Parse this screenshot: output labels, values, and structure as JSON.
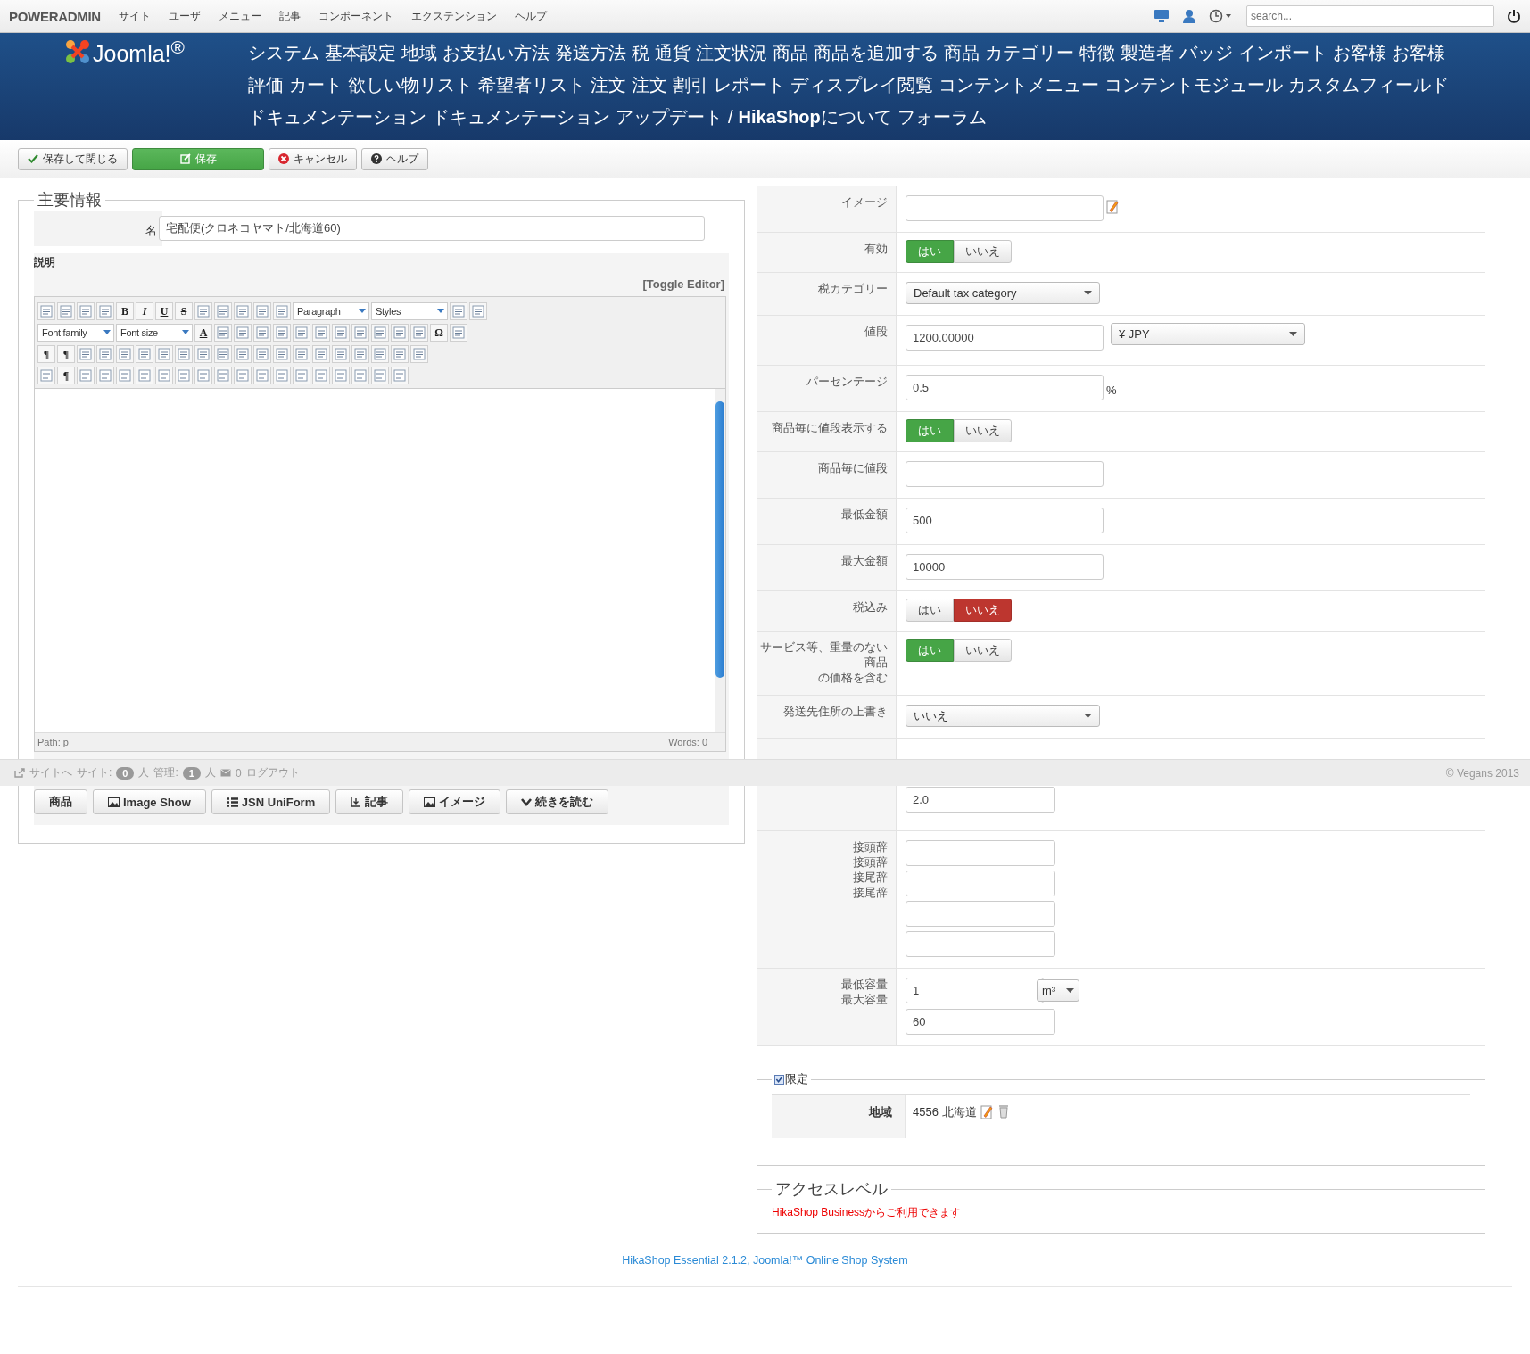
{
  "topbar": {
    "brand": "POWERADMIN",
    "menu": [
      "サイト",
      "ユーザ",
      "メニュー",
      "記事",
      "コンポーネント",
      "エクステンション",
      "ヘルプ"
    ],
    "search": {
      "placeholder": "search..."
    }
  },
  "header": {
    "logo": "Joomla!$^{®}$",
    "nav": [
      "システム",
      "基本設定",
      "地域",
      "お支払い方法",
      "発送方法",
      "税",
      "通貨",
      "注文状況",
      "商品",
      "商品を追加する",
      "商品",
      "カテゴリー",
      "特徴",
      "製造者",
      "バッジ",
      "インポート",
      "お客様",
      "お客様",
      "評価",
      "カート",
      "欲しい物リスト",
      "希望者リスト",
      "注文",
      "注文",
      "割引",
      "レポート",
      "ディスプレイ閲覧",
      "コンテントメニュー",
      "コンテントモジュール",
      "カスタムフィールド",
      "ドキュメンテーション",
      "ドキュメンテーション",
      "アップデート",
      "/",
      "**HikaShop**について",
      "フォーラム"
    ]
  },
  "toolbar": [
    {
      "kind": "save_close",
      "label": "保存して閉じる"
    },
    {
      "kind": "save",
      "label": "保存"
    },
    {
      "kind": "cancel",
      "label": "キャンセル"
    },
    {
      "kind": "help",
      "label": "ヘルプ"
    }
  ],
  "main": {
    "legend": "主要情報",
    "name_label": "名",
    "name_value": "宅配便(クロネコヤマト/北海道60)",
    "description_label": "説明",
    "toggle_editor": "[Toggle Editor]",
    "editor_rows": [
      [
        {
          "kind": "icon"
        },
        {
          "kind": "icon"
        },
        {
          "kind": "icon"
        },
        {
          "kind": "icon"
        },
        {
          "kind": "bold",
          "label": "B"
        },
        {
          "kind": "italic",
          "label": "I"
        },
        {
          "kind": "underline",
          "label": "U"
        },
        {
          "kind": "strike",
          "label": "S"
        },
        {
          "kind": "icon"
        },
        {
          "kind": "icon"
        },
        {
          "kind": "icon"
        },
        {
          "kind": "icon"
        },
        {
          "kind": "icon"
        },
        {
          "kind": "select",
          "label": "Paragraph"
        },
        {
          "kind": "select",
          "label": "Styles"
        },
        {
          "kind": "icon"
        },
        {
          "kind": "icon"
        }
      ],
      [
        {
          "kind": "select",
          "label": "Font family"
        },
        {
          "kind": "select",
          "label": "Font size"
        },
        {
          "kind": "underline",
          "label": "A"
        },
        {
          "kind": "icon"
        },
        {
          "kind": "icon"
        },
        {
          "kind": "icon"
        },
        {
          "kind": "icon"
        },
        {
          "kind": "icon"
        },
        {
          "kind": "icon"
        },
        {
          "kind": "icon"
        },
        {
          "kind": "icon"
        },
        {
          "kind": "icon"
        },
        {
          "kind": "icon"
        },
        {
          "kind": "icon"
        },
        {
          "kind": "text",
          "label": "Ω"
        },
        {
          "kind": "icon"
        }
      ],
      [
        {
          "kind": "text",
          "label": "¶"
        },
        {
          "kind": "text",
          "label": "¶"
        },
        {
          "kind": "icon"
        },
        {
          "kind": "icon"
        },
        {
          "kind": "icon"
        },
        {
          "kind": "icon"
        },
        {
          "kind": "icon"
        },
        {
          "kind": "icon"
        },
        {
          "kind": "icon"
        },
        {
          "kind": "icon"
        },
        {
          "kind": "icon"
        },
        {
          "kind": "icon"
        },
        {
          "kind": "icon"
        },
        {
          "kind": "icon"
        },
        {
          "kind": "icon"
        },
        {
          "kind": "icon"
        },
        {
          "kind": "icon"
        },
        {
          "kind": "icon"
        },
        {
          "kind": "icon"
        },
        {
          "kind": "icon"
        }
      ],
      [
        {
          "kind": "icon"
        },
        {
          "kind": "text",
          "label": "¶"
        },
        {
          "kind": "icon"
        },
        {
          "kind": "icon"
        },
        {
          "kind": "icon"
        },
        {
          "kind": "icon"
        },
        {
          "kind": "icon"
        },
        {
          "kind": "icon"
        },
        {
          "kind": "icon"
        },
        {
          "kind": "icon"
        },
        {
          "kind": "icon"
        },
        {
          "kind": "icon"
        },
        {
          "kind": "icon"
        },
        {
          "kind": "icon"
        },
        {
          "kind": "icon"
        },
        {
          "kind": "icon"
        },
        {
          "kind": "icon"
        },
        {
          "kind": "icon"
        },
        {
          "kind": "icon"
        }
      ]
    ],
    "path": "Path:  p",
    "words": "Words: 0",
    "editor_buttons": [
      {
        "kind": "plain",
        "label": "商品"
      },
      {
        "kind": "image",
        "label": "Image Show"
      },
      {
        "kind": "list",
        "label": "JSN UniForm"
      },
      {
        "kind": "article",
        "label": "記事"
      },
      {
        "kind": "image",
        "label": "イメージ"
      },
      {
        "kind": "more",
        "label": "続きを読む"
      }
    ]
  },
  "fields": [
    {
      "kind": "image",
      "labels": [
        "イメージ"
      ]
    },
    {
      "kind": "toggle",
      "labels": [
        "有効"
      ],
      "options": [
        {
          "kind": "yes",
          "label": "はい",
          "selected": true
        },
        {
          "kind": "no",
          "label": "いいえ",
          "selected": false
        }
      ]
    },
    {
      "kind": "select",
      "labels": [
        "税カテゴリー"
      ],
      "value": "Default tax category"
    },
    {
      "kind": "price",
      "labels": [
        "値段"
      ],
      "value": "1200.00000",
      "unit": "¥  JPY"
    },
    {
      "kind": "percent",
      "labels": [
        "パーセンテージ"
      ],
      "value": "0.5",
      "suffix": "%"
    },
    {
      "kind": "toggle",
      "labels": [
        "商品毎に値段表示する"
      ],
      "options": [
        {
          "kind": "yes",
          "label": "はい",
          "selected": true
        },
        {
          "kind": "no",
          "label": "いいえ",
          "selected": false
        }
      ]
    },
    {
      "kind": "input",
      "labels": [
        "商品毎に値段"
      ]
    },
    {
      "kind": "input",
      "labels": [
        "最低金額"
      ],
      "value": "500"
    },
    {
      "kind": "input",
      "labels": [
        "最大金額"
      ],
      "value": "10000"
    },
    {
      "kind": "toggle",
      "labels": [
        "税込み"
      ],
      "options": [
        {
          "kind": "yes",
          "label": "はい",
          "selected": false
        },
        {
          "kind": "no",
          "label": "いいえ",
          "selected": true
        }
      ]
    },
    {
      "kind": "toggle",
      "labels": [
        "サービス等、重量のない",
        "商品",
        "の価格を含む"
      ],
      "options": [
        {
          "kind": "yes",
          "label": "はい",
          "selected": true
        },
        {
          "kind": "no",
          "label": "いいえ",
          "selected": false
        }
      ]
    },
    {
      "kind": "select",
      "labels": [
        "発送先住所の上書き"
      ],
      "value": "いいえ"
    },
    {
      "kind": "weight",
      "value": "2.0"
    },
    {
      "kind": "affix",
      "labels": [
        "接頭辞",
        "接頭辞",
        "接尾辞",
        "接尾辞"
      ]
    },
    {
      "kind": "volume",
      "labels": [
        "最低容量",
        "最大容量"
      ],
      "values": [
        "1",
        "60"
      ],
      "unit": "m³"
    }
  ],
  "limit": {
    "checked": true,
    "legend": "限定",
    "label": "地域",
    "value": "4556 北海道"
  },
  "access": {
    "legend": "アクセスレベル",
    "note": "HikaShop Businessからご利用できます"
  },
  "footer_link": "HikaShop Essential 2.1.2, Joomla!™ Online Shop System",
  "status_bar": {
    "site_link": "サイトへ",
    "site_label": "サイト:",
    "site_count": "0",
    "site_unit": "人",
    "admin_label": "管理:",
    "admin_count": "1",
    "admin_unit": "人",
    "mail_count": "0",
    "logout": "ログアウト",
    "copyright": "© Vegans 2013"
  }
}
